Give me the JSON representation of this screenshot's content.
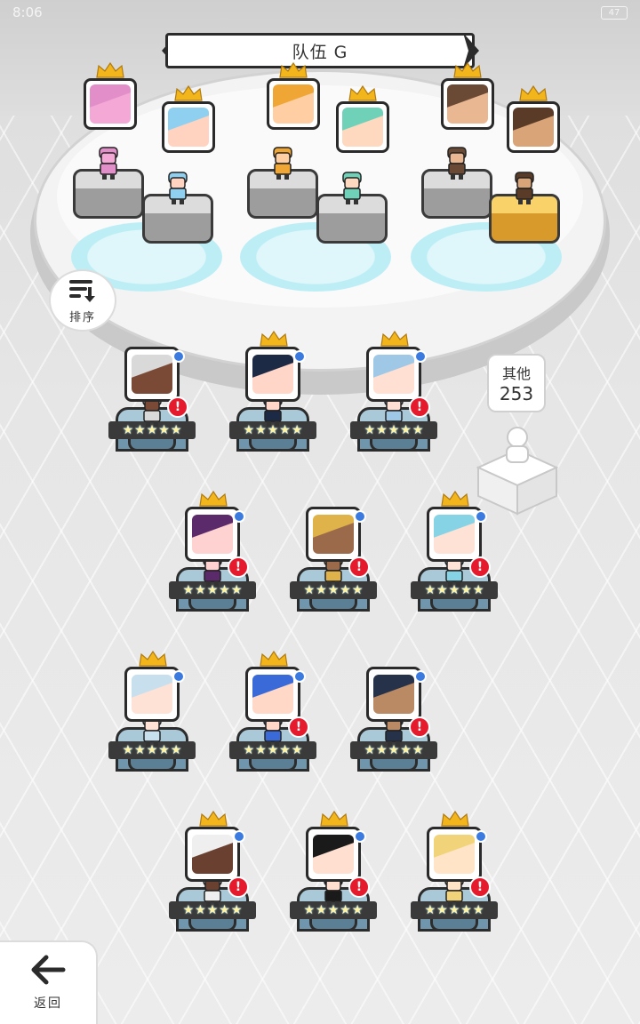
{
  "status": {
    "time": "8:06",
    "battery": "47"
  },
  "header": {
    "team_name": "队伍 G"
  },
  "sort": {
    "label": "排序"
  },
  "others": {
    "label": "其他",
    "count": "253"
  },
  "back": {
    "label": "返回"
  },
  "stars": [
    "★",
    "★",
    "★",
    "★",
    "★"
  ],
  "colors": {
    "alert": "#e51b2d",
    "badge": "#3b7be0",
    "crown": "#f2b51c"
  },
  "team_slots": [
    {
      "face": "#f3a8d6",
      "hair": "#e28fc9",
      "leader": true
    },
    {
      "face": "#ffd3c0",
      "hair": "#8fd0f0",
      "leader": true
    },
    {
      "face": "#ffcfa3",
      "hair": "#f0a634",
      "leader": true
    },
    {
      "face": "#ffd8c0",
      "hair": "#6fd1b8",
      "leader": true
    },
    {
      "face": "#e9b893",
      "hair": "#6a4a35",
      "leader": true
    },
    {
      "face": "#d9a478",
      "hair": "#5a3b28",
      "leader": true
    }
  ],
  "bench": [
    {
      "face": "#7a4a36",
      "hair": "#d9d9d9",
      "leader": false,
      "alert": true
    },
    {
      "face": "#ffd6c8",
      "hair": "#1d2a45",
      "leader": true,
      "alert": false
    },
    {
      "face": "#ffe0d2",
      "hair": "#9fc7e6",
      "leader": true,
      "alert": true
    },
    {
      "face": "#ffd2d2",
      "hair": "#5a2a6a",
      "leader": true,
      "alert": true
    },
    {
      "face": "#9a6a4a",
      "hair": "#e0b24a",
      "leader": false,
      "alert": true
    },
    {
      "face": "#ffe2d6",
      "hair": "#86d3e6",
      "leader": true,
      "alert": true
    },
    {
      "face": "#ffe2d6",
      "hair": "#c8dfee",
      "leader": true,
      "alert": false
    },
    {
      "face": "#ffd8c8",
      "hair": "#3a6ad8",
      "leader": true,
      "alert": true
    },
    {
      "face": "#b98a64",
      "hair": "#25324a",
      "leader": false,
      "alert": true
    },
    {
      "face": "#6a4030",
      "hair": "#efefef",
      "leader": true,
      "alert": true
    },
    {
      "face": "#ffe0d0",
      "hair": "#1a1a1a",
      "leader": true,
      "alert": true
    },
    {
      "face": "#ffe4c8",
      "hair": "#f1d37a",
      "leader": true,
      "alert": true
    }
  ]
}
